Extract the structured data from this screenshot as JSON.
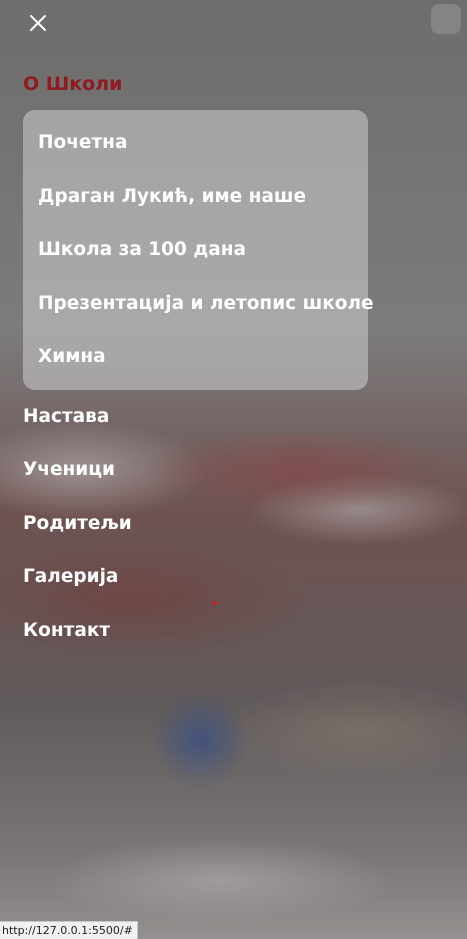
{
  "close_icon": "close-icon",
  "menu": {
    "section_title": "О Школи",
    "section_color": "#8f1a1f",
    "submenu": [
      {
        "label": "Почетна"
      },
      {
        "label": "Драган Лукић, име наше"
      },
      {
        "label": "Школа за 100 дана"
      },
      {
        "label": "Презентација и летопис школе"
      },
      {
        "label": "Химна"
      }
    ],
    "items": [
      {
        "label": "Настава"
      },
      {
        "label": "Ученици"
      },
      {
        "label": "Родитељи"
      },
      {
        "label": "Галерија"
      },
      {
        "label": "Контакт"
      }
    ]
  },
  "status_bar": {
    "url": "http://127.0.0.1:5500/#"
  }
}
